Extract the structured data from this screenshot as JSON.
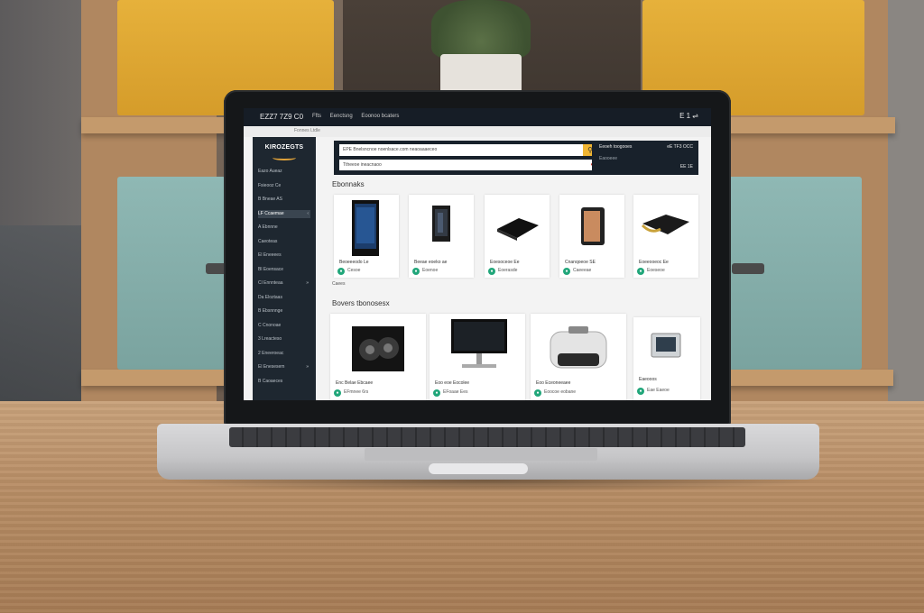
{
  "topbar": {
    "brand": "EZZ7 7Z9 C0",
    "nav": [
      "Ffts",
      "Eenctsng",
      "Eoonoo bcaters"
    ],
    "right": "E 1 ⇌"
  },
  "breadcrumb": "Fonnes  Ltdle",
  "sidebar": {
    "logo": "KIROZEGTS",
    "items": [
      {
        "label": "Eazo Aueaz",
        "active": false,
        "chev": ""
      },
      {
        "label": "Fsieooz Ce",
        "active": false,
        "chev": ""
      },
      {
        "label": "B Bneae AS",
        "active": false,
        "chev": ""
      },
      {
        "label": "LF Ccaemae",
        "active": true,
        "chev": "‹"
      },
      {
        "label": "A Ebnnne",
        "active": false,
        "chev": ""
      },
      {
        "label": "Caeoteas",
        "active": false,
        "chev": ""
      },
      {
        "label": "El Eneeees",
        "active": false,
        "chev": ""
      },
      {
        "label": "Bl Eoensace",
        "active": false,
        "chev": ""
      },
      {
        "label": "Cl Ennnteaa",
        "active": false,
        "chev": "»"
      },
      {
        "label": "Da Eloztaas",
        "active": false,
        "chev": ""
      },
      {
        "label": "B Ebsnnnge",
        "active": false,
        "chev": ""
      },
      {
        "label": "C Cnonoae",
        "active": false,
        "chev": ""
      },
      {
        "label": "3 Lreacteso",
        "active": false,
        "chev": ""
      },
      {
        "label": "2 Eneeroeac",
        "active": false,
        "chev": ""
      },
      {
        "label": "El Enesesem",
        "active": false,
        "chev": "»"
      },
      {
        "label": "B Caoaeces",
        "active": false,
        "chev": ""
      }
    ]
  },
  "search": {
    "value": "EPE  Bnelsncnoe noenlsace.com  neaoaaaeceo",
    "second": "Ttheeoe ineacnaoo",
    "clear": "●"
  },
  "cart": {
    "t1": "Eeoeh toogooes",
    "t2": "eE  TF3  OCC",
    "t3": "Eaooeee",
    "t4": "EE  1E"
  },
  "section1": {
    "title": "Ebonnaks",
    "products": [
      {
        "name": "Beoeeeodo  Le",
        "price": "Cesoe"
      },
      {
        "name": "Beeae eoeko  ae",
        "price": "Eoenoe"
      },
      {
        "name": "Eoesoceoe  Ee",
        "price": "Eoerasde"
      },
      {
        "name": "Cnanqoeoe  SE",
        "price": "Caeeeae"
      },
      {
        "name": "Eoeeooeoc  Ee",
        "price": "Eoeseoe"
      }
    ],
    "more": "Caees"
  },
  "section2": {
    "title": "Bovers tbonosesx",
    "products": [
      {
        "name": "Enc Belae  Ebcaee",
        "price": "EFmnee 6rs"
      },
      {
        "name": "Eoo eoe  Eocolee",
        "price": "EFoaae Ees"
      },
      {
        "name": "Eoo Eceoneeaee",
        "price": "Eoocoe eobane"
      },
      {
        "name": "Eaeooos",
        "price": "Eae  Eaeoe"
      }
    ]
  },
  "colors": {
    "topbar": "#161d26",
    "sidebar": "#1e2730",
    "search_button": "#f1b633",
    "badge": "#21a67a"
  }
}
